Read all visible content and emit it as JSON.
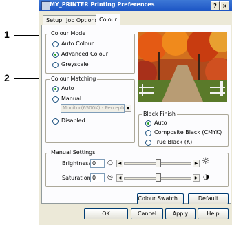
{
  "window": {
    "title": "MY_PRINTER Printing Preferences",
    "help_button": "?",
    "close_button": "×"
  },
  "callouts": [
    "1",
    "2"
  ],
  "tabs": [
    "Setup",
    "Job Options",
    "Colour"
  ],
  "colour_mode": {
    "title": "Colour Mode",
    "options": [
      "Auto Colour",
      "Advanced Colour",
      "Greyscale"
    ],
    "selected": "Advanced Colour"
  },
  "colour_matching": {
    "title": "Colour Matching",
    "options": [
      "Auto",
      "Manual",
      "Disabled"
    ],
    "selected": "Auto",
    "manual_value": "Monitor(6500K) - Perceptual"
  },
  "black_finish": {
    "title": "Black Finish",
    "options": [
      "Auto",
      "Composite Black (CMYK)",
      "True Black (K)"
    ],
    "selected": "Auto"
  },
  "manual_settings": {
    "title": "Manual Settings",
    "brightness_label": "Brightness:",
    "brightness_value": "0",
    "saturation_label": "Saturation:",
    "saturation_value": "0"
  },
  "buttons": {
    "colour_swatch": "Colour Swatch...",
    "default": "Default",
    "ok": "OK",
    "cancel": "Cancel",
    "apply": "Apply",
    "help": "Help"
  },
  "icons": {
    "brightness": "sun-icon",
    "saturation": "half-circle-icon"
  }
}
